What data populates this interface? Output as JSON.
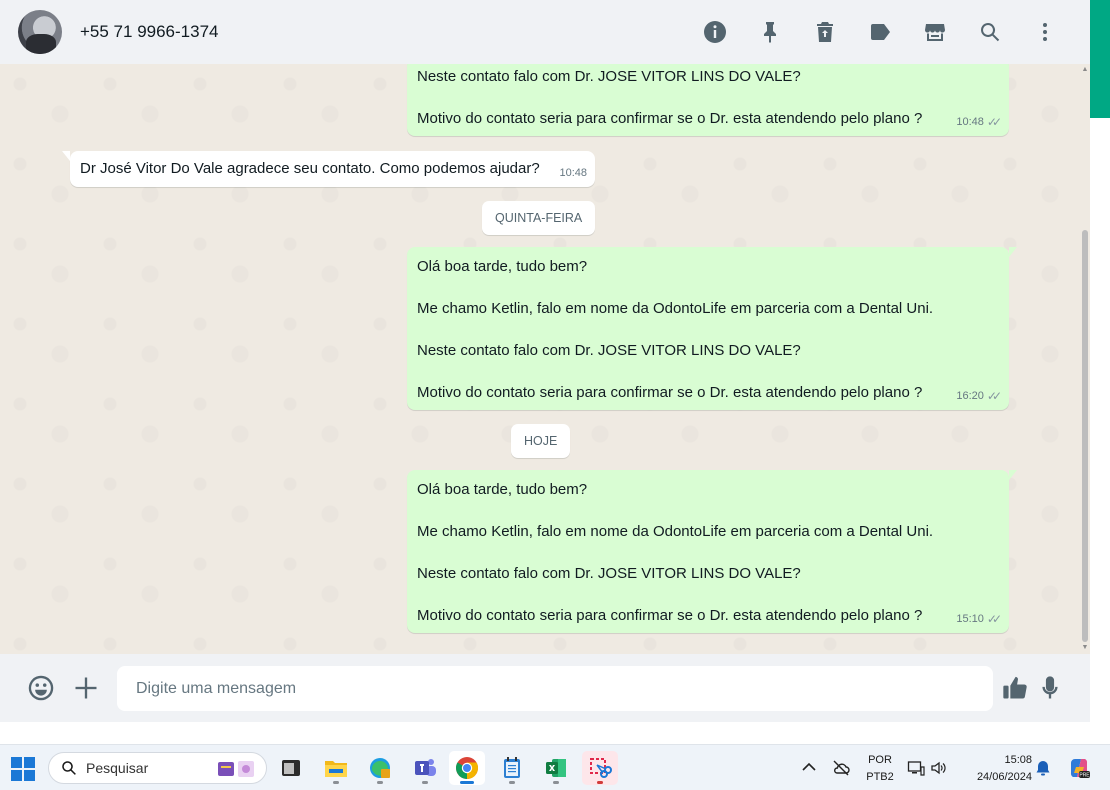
{
  "header": {
    "contact_name": "+55 71 9966-1374",
    "actions": [
      "info-icon",
      "pin-icon",
      "delete-icon",
      "label-icon",
      "store-icon",
      "search-icon",
      "menu-icon"
    ]
  },
  "messages": [
    {
      "direction": "outgoing",
      "lines": [
        "Neste contato falo com Dr. JOSE VITOR LINS DO VALE?",
        "",
        "Motivo do contato seria para confirmar se o Dr. esta atendendo pelo plano ?"
      ],
      "time": "10:48",
      "status": "read"
    },
    {
      "direction": "incoming",
      "lines": [
        "Dr José Vitor Do Vale agradece seu contato. Como podemos ajudar?"
      ],
      "time": "10:48"
    },
    {
      "date_chip": "QUINTA-FEIRA"
    },
    {
      "direction": "outgoing",
      "lines": [
        "Olá boa tarde, tudo bem?",
        "",
        "Me chamo Ketlin, falo em nome da OdontoLife em parceria com a Dental Uni.",
        "",
        "Neste contato falo com Dr. JOSE VITOR LINS DO VALE?",
        "",
        "Motivo do contato seria para confirmar se o Dr. esta atendendo pelo plano ?"
      ],
      "time": "16:20",
      "status": "read"
    },
    {
      "date_chip": "HOJE"
    },
    {
      "direction": "outgoing",
      "lines": [
        "Olá boa tarde, tudo bem?",
        "",
        "Me chamo Ketlin, falo em nome da OdontoLife em parceria com a Dental Uni.",
        "",
        "Neste contato falo com Dr. JOSE VITOR LINS DO VALE?",
        "",
        "Motivo do contato seria para confirmar se o Dr. esta atendendo pelo plano ?"
      ],
      "time": "15:10",
      "status": "read"
    }
  ],
  "composer": {
    "placeholder": "Digite uma mensagem"
  },
  "taskbar": {
    "search_label": "Pesquisar",
    "apps": [
      "terminal",
      "file-explorer",
      "edge",
      "teams",
      "chrome",
      "notepad",
      "excel",
      "snipping-tool"
    ],
    "active_app": "chrome",
    "language": "POR",
    "keyboard": "PTB2",
    "time": "15:08",
    "date": "24/06/2024"
  },
  "colors": {
    "outgoing_bubble": "#d9fdd3",
    "incoming_bubble": "#ffffff",
    "chat_background": "#efeae2",
    "accent": "#00a884"
  }
}
